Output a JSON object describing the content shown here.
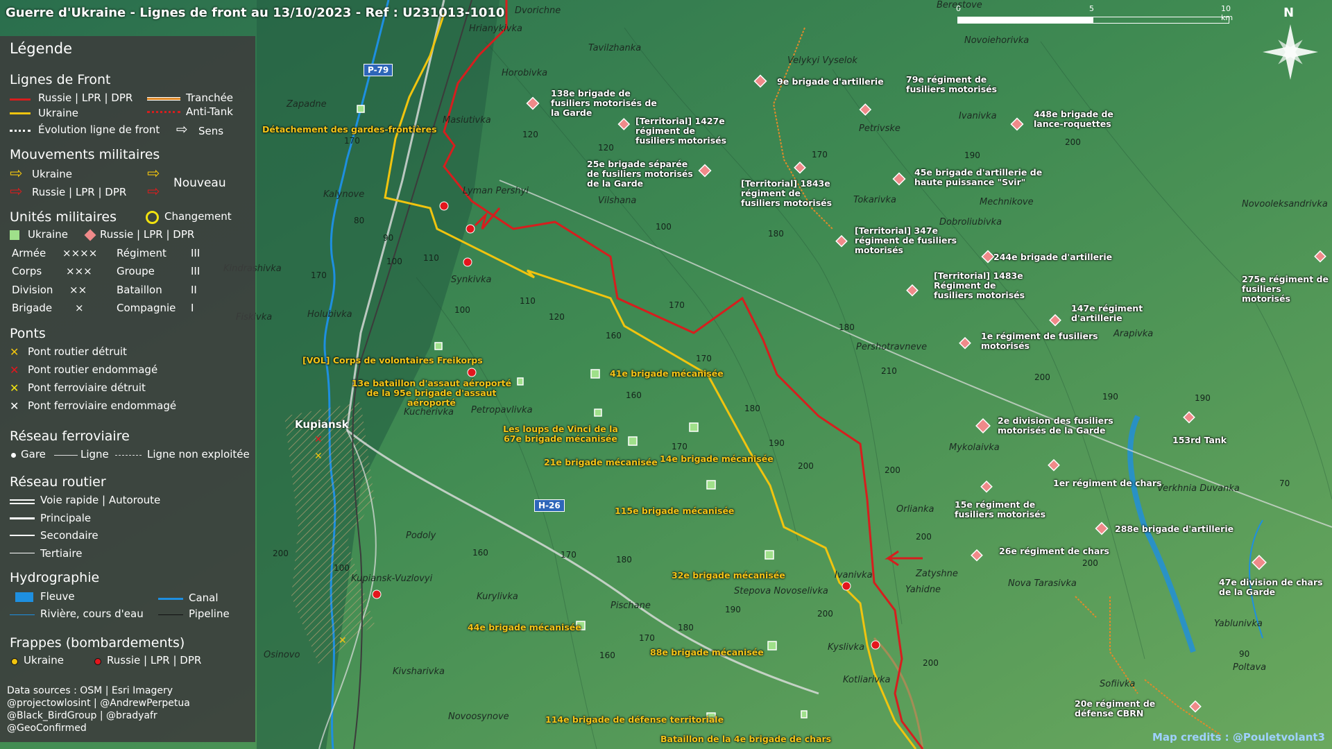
{
  "title": "Guerre d'Ukraine - Lignes de front au 13/10/2023 - Ref : U231013-1010",
  "colors": {
    "russia": "#d61e1e",
    "ukraine": "#f1c40f",
    "legend_bg": "#3c3c3c"
  },
  "legend": {
    "title": "Légende",
    "front_lines": {
      "heading": "Lignes de Front",
      "russia": "Russie | LPR | DPR",
      "ukraine": "Ukraine",
      "evolution": "Évolution ligne de front",
      "trench": "Tranchée",
      "antitank": "Anti-Tank",
      "direction": "Sens"
    },
    "movements": {
      "heading": "Mouvements militaires",
      "ukraine": "Ukraine",
      "russia": "Russie | LPR | DPR",
      "new": "Nouveau"
    },
    "units": {
      "heading": "Unités militaires",
      "change": "Changement",
      "ukraine": "Ukraine",
      "russia": "Russie | LPR | DPR",
      "rows": [
        {
          "a": "Armée",
          "as": "××××",
          "b": "Régiment",
          "bs": "III"
        },
        {
          "a": "Corps",
          "as": "×××",
          "b": "Groupe",
          "bs": "III"
        },
        {
          "a": "Division",
          "as": "××",
          "b": "Bataillon",
          "bs": "II"
        },
        {
          "a": "Brigade",
          "as": "×",
          "b": "Compagnie",
          "bs": "I"
        }
      ]
    },
    "bridges": {
      "heading": "Ponts",
      "items": [
        "Pont routier détruit",
        "Pont routier endommagé",
        "Pont ferroviaire détruit",
        "Pont ferroviaire endommagé"
      ]
    },
    "rail": {
      "heading": "Réseau ferroviaire",
      "station": "Gare",
      "line": "Ligne",
      "unused": "Ligne non exploitée"
    },
    "road": {
      "heading": "Réseau routier",
      "items": [
        "Voie rapide | Autoroute",
        "Principale",
        "Secondaire",
        "Tertiaire"
      ]
    },
    "hydro": {
      "heading": "Hydrographie",
      "river_big": "Fleuve",
      "canal": "Canal",
      "river": "Rivière, cours d'eau",
      "pipeline": "Pipeline"
    },
    "strikes": {
      "heading": "Frappes (bombardements)",
      "ukraine": "Ukraine",
      "russia": "Russie | LPR | DPR"
    },
    "sources": [
      "Data sources : OSM | Esri Imagery",
      "@projectowlosint | @AndrewPerpetua",
      "@Black_BirdGroup | @bradyafr",
      "@GeoConfirmed"
    ]
  },
  "scale": {
    "labels": [
      "0",
      "5",
      "10 km"
    ]
  },
  "north": "N",
  "credits": "Map credits : @Pouletvolant3",
  "road_badges": [
    "P-79",
    "H-26"
  ],
  "places": [
    "Dvorichne",
    "Hrianykivka",
    "Berestove",
    "Tavilzhanka",
    "Horobivka",
    "Velykyi Vyselok",
    "Novoiehorivka",
    "Zapadne",
    "Masiutivka",
    "Petrivske",
    "Ivanivka",
    "Kalynove",
    "Lyman Pershyi",
    "Vilshana",
    "Tokarivka",
    "Mechnikove",
    "Novooleksandrivka",
    "Dobroliubivka",
    "Synkivka",
    "Kindrashivka",
    "Pershotravneve",
    "Holubivka",
    "Arapivka",
    "Fiskivka",
    "Kucherivka",
    "Petropavlivka",
    "Mykolaivka",
    "Verkhnia Duvanka",
    "Orlianka",
    "Podoly",
    "Kupiansk-Vuzlovyi",
    "Kurylivka",
    "Pischane",
    "Ivanivka",
    "Zatyshne",
    "Yahidne",
    "Nova Tarasivka",
    "Stepova Novoselivka",
    "Kyslivka",
    "Yablunivka",
    "Osinovo",
    "Kivsharivka",
    "Kotliarivka",
    "Sofiivka",
    "Poltava",
    "Novoosynove"
  ],
  "kupiansk": "Kupiansk",
  "units_ru": [
    "138e brigade de fusiliers motorisés de la Garde",
    "9e brigade d'artillerie",
    "79e régiment de fusiliers motorisés",
    "[Territorial] 1427e régiment de fusiliers motorisés",
    "448e brigade de lance-roquettes",
    "25e brigade séparée de fusiliers motorisés de la Garde",
    "45e brigade d'artillerie de haute puissance \"Svir\"",
    "[Territorial] 1843e régiment de fusiliers motorisés",
    "[Territorial] 347e régiment de fusiliers motorisés",
    "244e brigade d'artillerie",
    "[Territorial] 1483e Régiment de fusiliers motorisés",
    "275e régiment de fusiliers motorisés",
    "147e régiment d'artillerie",
    "1e régiment de fusiliers motorisés",
    "2e division des fusiliers motorisés de la Garde",
    "153rd Tank",
    "1er régiment de chars",
    "15e régiment de fusiliers motorisés",
    "288e brigade d'artillerie",
    "26e régiment de chars",
    "47e division de chars de la Garde",
    "20e régiment de défense CBRN"
  ],
  "units_ua": [
    "Détachement des gardes-frontières",
    "[VOL] Corps de volontaires Freikorps",
    "41e brigade mécanisée",
    "13e bataillon d'assaut aéroporté de la 95e brigade d'assaut aéroporté",
    "Les loups de Vinci de la 67e brigade mécanisée",
    "21e brigade mécanisée",
    "14e brigade mécanisée",
    "115e brigade mécanisée",
    "32e brigade mécanisée",
    "44e brigade mécanisée",
    "88e brigade mécanisée",
    "114e brigade de défense territoriale",
    "Bataillon de la 4e brigade de chars"
  ],
  "contours": [
    "170",
    "120",
    "120",
    "100",
    "170",
    "190",
    "200",
    "80",
    "90",
    "100",
    "110",
    "170",
    "110",
    "120",
    "100",
    "160",
    "170",
    "180",
    "170",
    "180",
    "210",
    "200",
    "190",
    "160",
    "170",
    "180",
    "190",
    "200",
    "200",
    "200",
    "200",
    "70",
    "100",
    "160",
    "170",
    "180",
    "190",
    "200",
    "180",
    "170",
    "160",
    "200",
    "200",
    "190",
    "90"
  ]
}
